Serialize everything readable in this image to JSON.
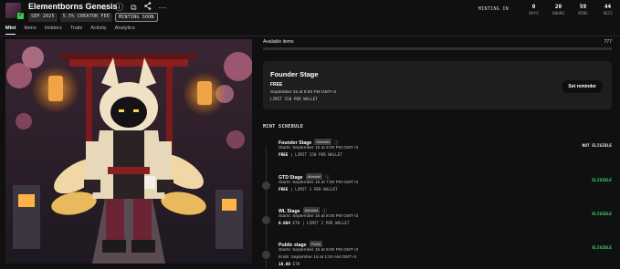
{
  "header": {
    "collection_name": "Elementborns Genesis",
    "tags": [
      "SEP 2025",
      "5.5% CREATOR FEE",
      "MINTING SOON"
    ],
    "icons": [
      "star-icon",
      "info-icon",
      "copy-icon",
      "share-icon",
      "more-icon"
    ]
  },
  "countdown": {
    "label": "MINTING IN",
    "units": [
      {
        "value": "0",
        "label": "DAYS"
      },
      {
        "value": "20",
        "label": "HOURS"
      },
      {
        "value": "59",
        "label": "MINS"
      },
      {
        "value": "44",
        "label": "SECS"
      }
    ]
  },
  "tabs": [
    "Mint",
    "Items",
    "Holders",
    "Traits",
    "Activity",
    "Analytics"
  ],
  "available": {
    "label": "Available items",
    "count": "777",
    "progress": 0
  },
  "current_stage": {
    "title": "Founder Stage",
    "price": "FREE",
    "date": "September 15 at 6:00 PM GMT+2",
    "limit": "LIMIT 150 PER WALLET",
    "button_label": "Set reminder"
  },
  "schedule": {
    "title": "MINT SCHEDULE",
    "stages": [
      {
        "name": "Founder Stage",
        "badge": "Allowlist",
        "line1": "Starts: September 15 at 6:00 PM GMT+2",
        "price": "FREE",
        "limit": " | LIMIT 150 PER WALLET",
        "line3": "",
        "status": "NOT ELIGIBLE",
        "eligible": false
      },
      {
        "name": "GTD Stage",
        "badge": "Allowlist",
        "line1": "Starts: September 15 at 7:00 PM GMT+2",
        "price": "FREE",
        "limit": " | LIMIT 1 PER WALLET",
        "line3": "",
        "status": "ELIGIBLE",
        "eligible": true
      },
      {
        "name": "WL Stage",
        "badge": "Allowlist",
        "line1": "Starts: September 15 at 8:00 PM GMT+2",
        "price": "0.004",
        "limit": " ETH | LIMIT 2 PER WALLET",
        "line3": "",
        "status": "ELIGIBLE",
        "eligible": true
      },
      {
        "name": "Public stage",
        "badge": "Public",
        "line1": "Starts: September 15 at 9:00 PM GMT+2",
        "price": "",
        "limit": "",
        "line2": "Ends: September 16 at 1:00 AM GMT+2",
        "line3price": "10.00",
        "line3unit": " ETH",
        "status": "ELIGIBLE",
        "eligible": true
      }
    ]
  },
  "colors": {
    "background": "#101010",
    "card": "#1e1e1e",
    "eligible": "#3ed36a",
    "creator_badge": "#3ec94a"
  }
}
